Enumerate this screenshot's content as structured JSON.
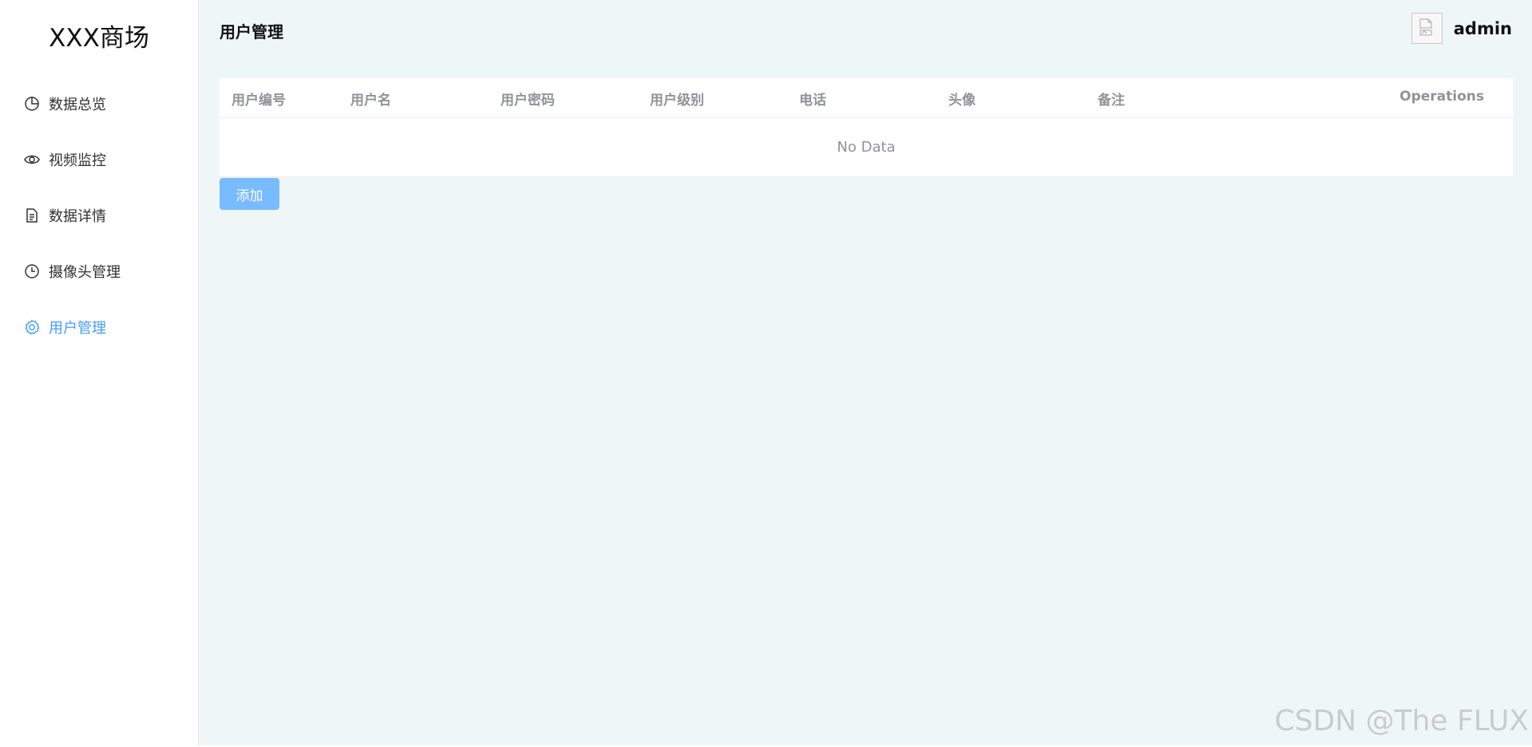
{
  "sidebar": {
    "logo": "XXX商场",
    "items": [
      {
        "label": "数据总览",
        "icon": "pie-chart-icon",
        "active": false
      },
      {
        "label": "视频监控",
        "icon": "eye-icon",
        "active": false
      },
      {
        "label": "数据详情",
        "icon": "document-icon",
        "active": false
      },
      {
        "label": "摄像头管理",
        "icon": "clock-icon",
        "active": false
      },
      {
        "label": "用户管理",
        "icon": "gear-icon",
        "active": true
      }
    ]
  },
  "header": {
    "title": "用户管理",
    "username": "admin",
    "avatar_icon": "broken-image-icon"
  },
  "table": {
    "columns": [
      "用户编号",
      "用户名",
      "用户密码",
      "用户级别",
      "电话",
      "头像",
      "备注"
    ],
    "operations_label": "Operations",
    "rows": [],
    "empty_text": "No Data"
  },
  "actions": {
    "add_label": "添加"
  },
  "watermark": "CSDN @The FLUX",
  "colors": {
    "accent": "#409eff",
    "button": "#79bbff",
    "main_bg": "#eff7f6",
    "header_text": "#909399"
  }
}
